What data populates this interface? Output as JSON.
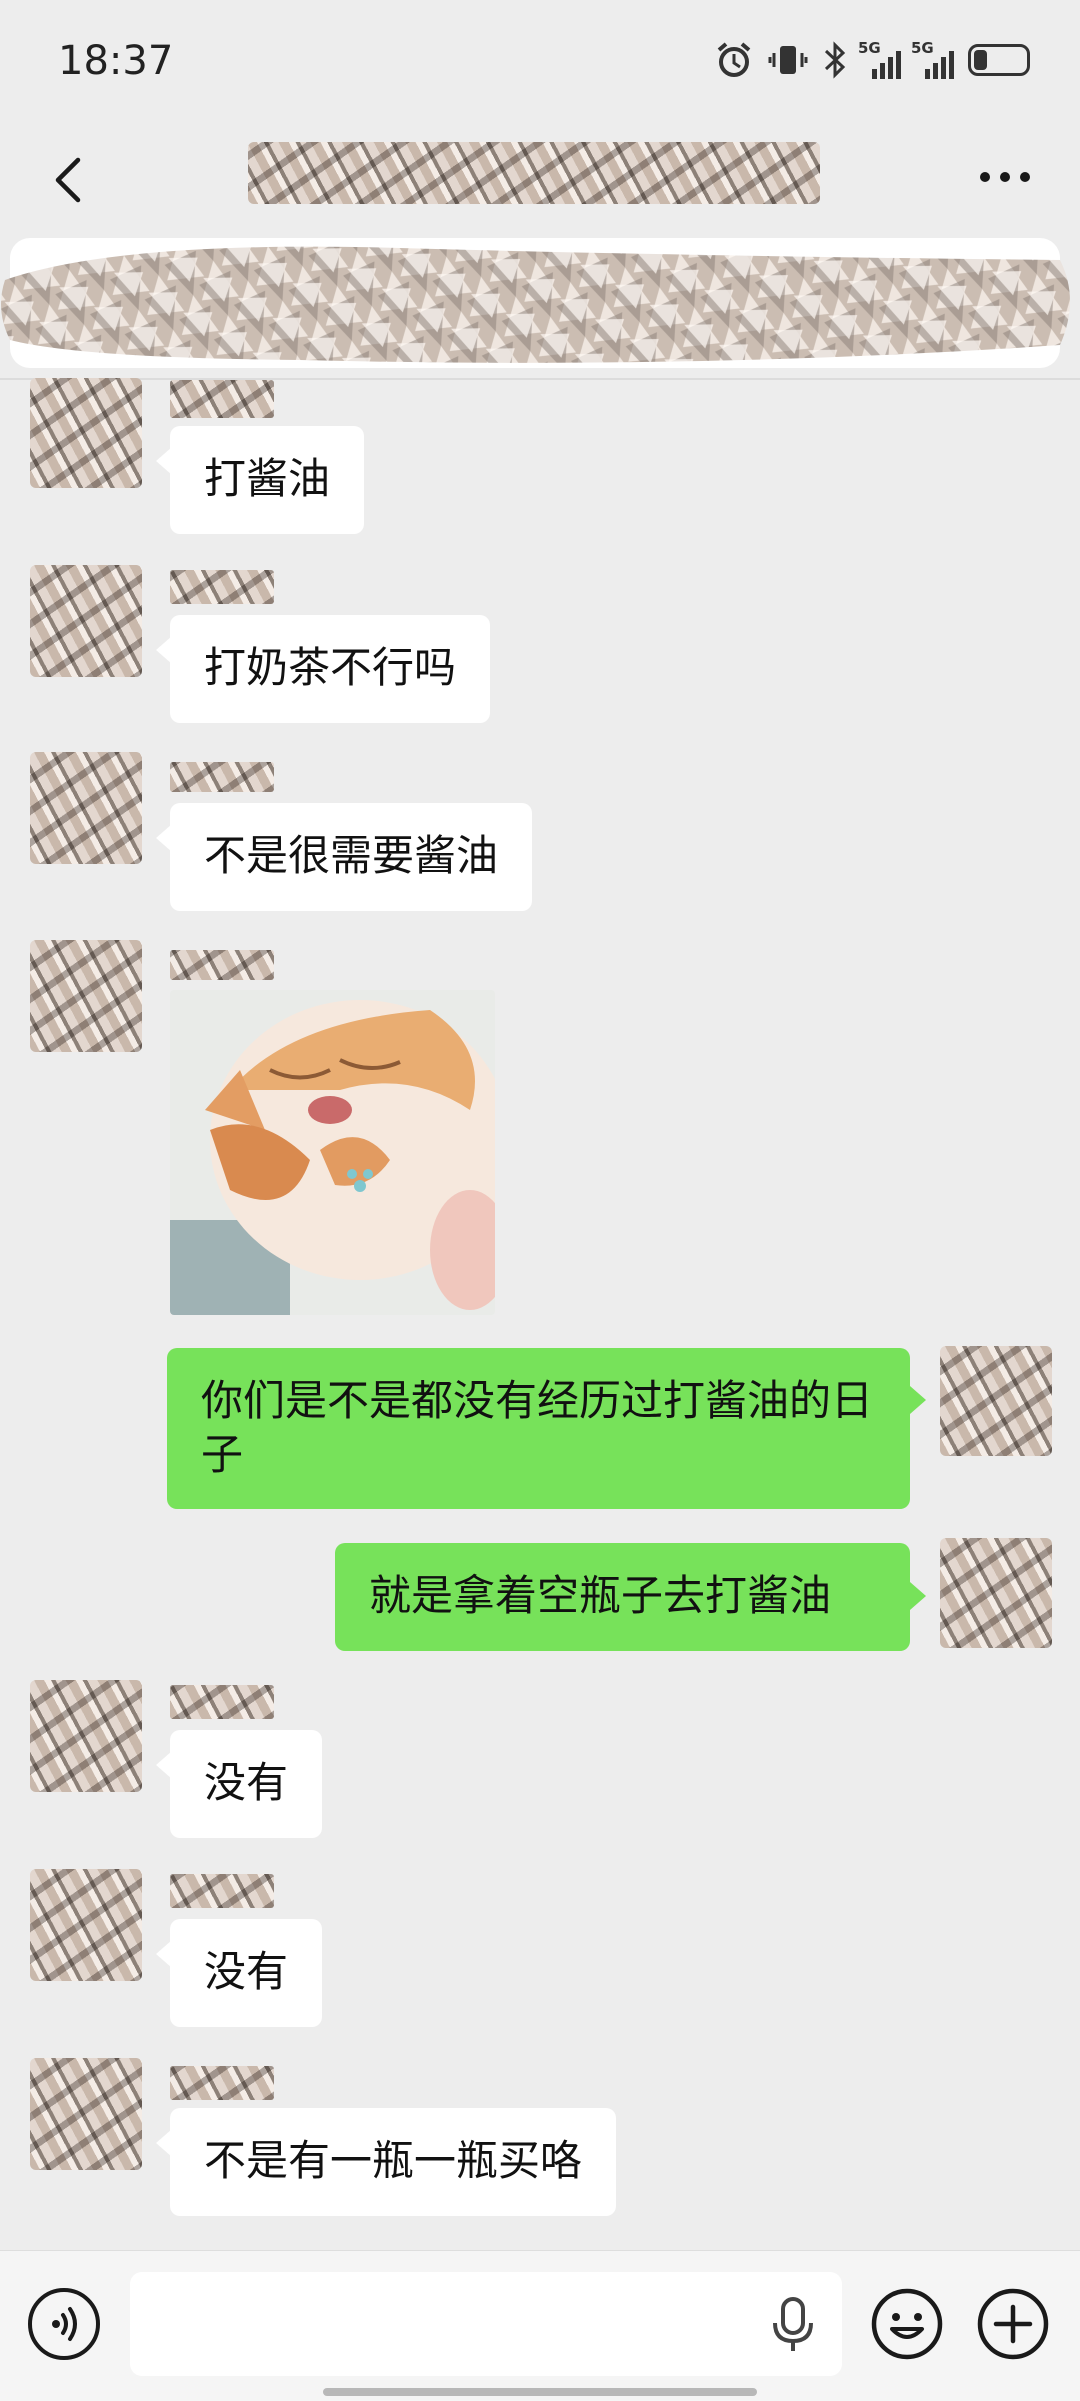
{
  "status": {
    "time": "18:37",
    "net1": "5G",
    "net2": "5G",
    "battery_level": 0.25
  },
  "header": {
    "title": "",
    "back_icon": "chevron-left-icon",
    "more_icon": "more-horizontal-icon"
  },
  "messages": [
    {
      "side": "left",
      "text": "打酱油"
    },
    {
      "side": "left",
      "text": "打奶茶不行吗"
    },
    {
      "side": "left",
      "text": "不是很需要酱油"
    },
    {
      "side": "left",
      "type": "sticker",
      "sticker": "orange-and-white cat squinting with a sweat drop"
    },
    {
      "side": "right",
      "text": "你们是不是都没有经历过打酱油的日子"
    },
    {
      "side": "right",
      "text": "就是拿着空瓶子去打酱油"
    },
    {
      "side": "left",
      "text": "没有"
    },
    {
      "side": "left",
      "text": "没有"
    },
    {
      "side": "left",
      "text": "不是有一瓶一瓶买咯"
    }
  ],
  "input": {
    "value": "",
    "placeholder": ""
  },
  "colors": {
    "background": "#ededed",
    "outgoing_bubble": "#77e25a",
    "incoming_bubble": "#ffffff"
  }
}
